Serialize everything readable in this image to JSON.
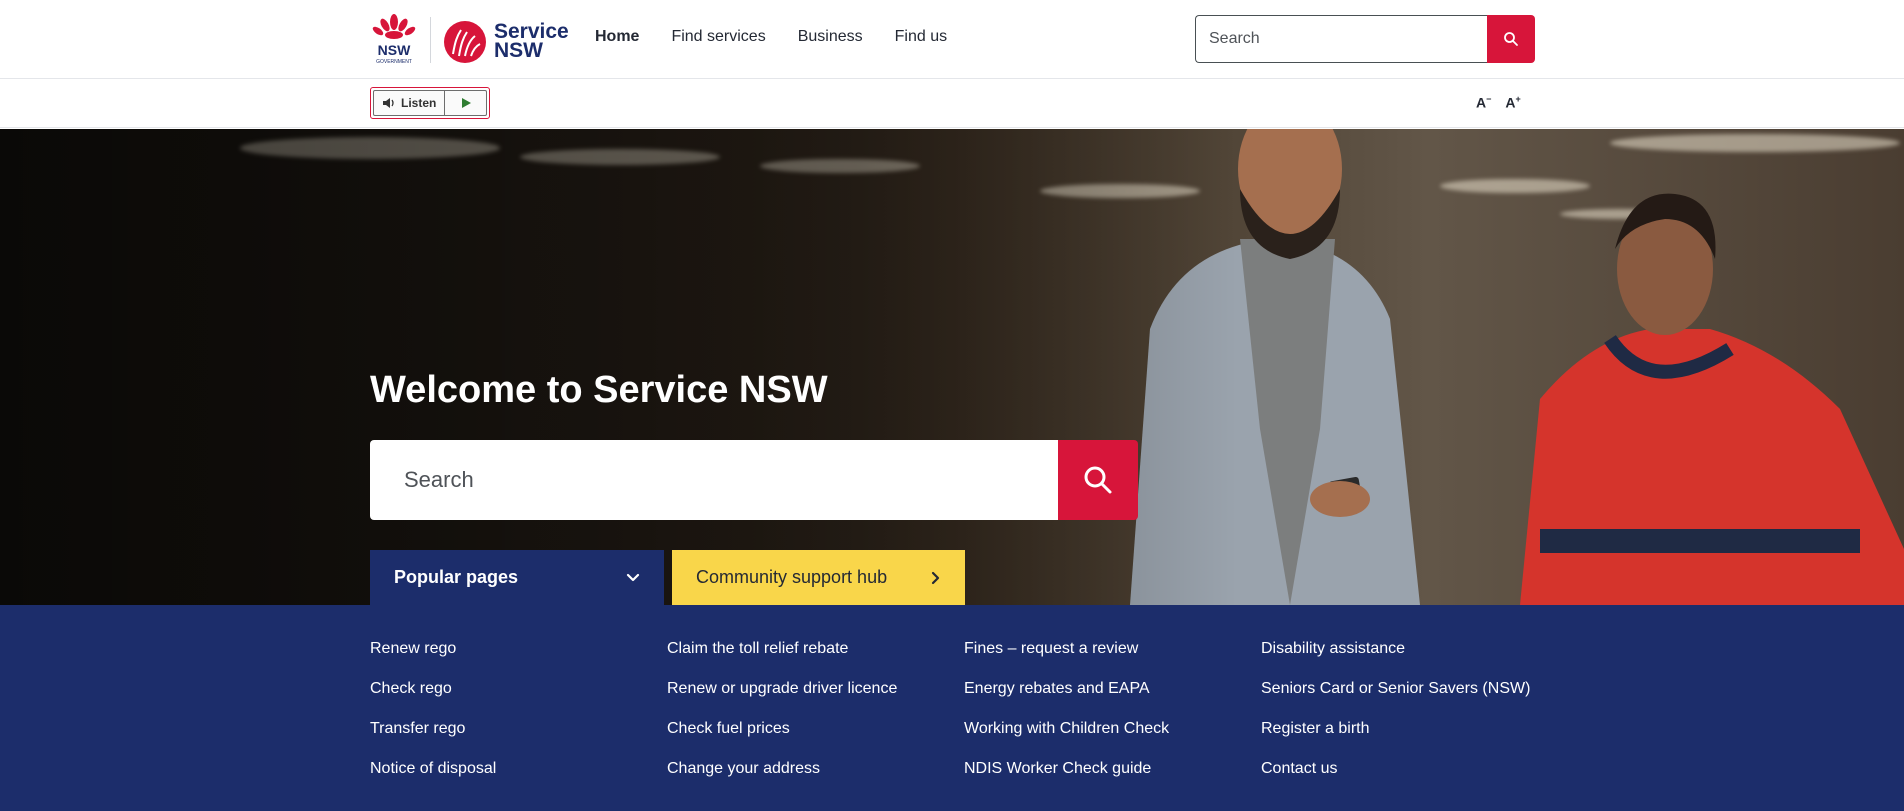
{
  "header": {
    "logo_nsw_text": "NSW",
    "logo_nsw_sub": "GOVERNMENT",
    "logo_service_line1": "Service",
    "logo_service_line2": "NSW",
    "nav": [
      "Home",
      "Find services",
      "Business",
      "Find us"
    ],
    "search_placeholder": "Search"
  },
  "utility": {
    "listen_label": "Listen",
    "font_decrease": "A",
    "font_increase": "A"
  },
  "hero": {
    "title": "Welcome to Service NSW",
    "search_placeholder": "Search",
    "popular_tab": "Popular pages",
    "community_tab": "Community support hub"
  },
  "popular_links": [
    [
      "Renew rego",
      "Check rego",
      "Transfer rego",
      "Notice of disposal"
    ],
    [
      "Claim the toll relief rebate",
      "Renew or upgrade driver licence",
      "Check fuel prices",
      "Change your address"
    ],
    [
      "Fines – request a review",
      "Energy rebates and EAPA",
      "Working with Children Check",
      "NDIS Worker Check guide"
    ],
    [
      "Disability assistance",
      "Seniors Card or Senior Savers (NSW)",
      "Register a birth",
      "Contact us"
    ]
  ],
  "colors": {
    "brand_navy": "#1c2d6b",
    "brand_red": "#d7153a",
    "accent_yellow": "#f9d64a"
  }
}
